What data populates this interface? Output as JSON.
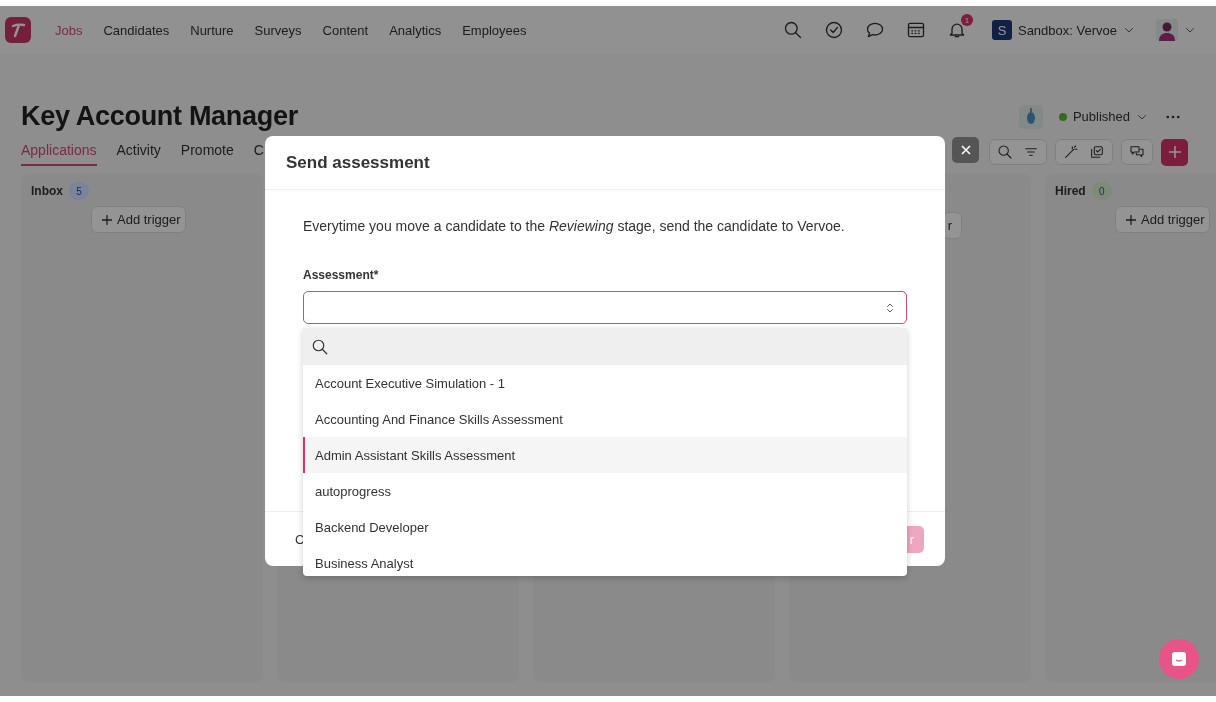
{
  "nav": {
    "items": [
      {
        "label": "Jobs",
        "selected": true
      },
      {
        "label": "Candidates",
        "selected": false
      },
      {
        "label": "Nurture",
        "selected": false
      },
      {
        "label": "Surveys",
        "selected": false
      },
      {
        "label": "Content",
        "selected": false
      },
      {
        "label": "Analytics",
        "selected": false
      },
      {
        "label": "Employees",
        "selected": false
      }
    ],
    "notification_count": "1",
    "workspace": {
      "initial": "S",
      "name": "Sandbox: Vervoe"
    }
  },
  "job": {
    "title": "Key Account Manager",
    "status": "Published"
  },
  "tabs": [
    {
      "label": "Applications",
      "selected": true
    },
    {
      "label": "Activity",
      "selected": false
    },
    {
      "label": "Promote",
      "selected": false
    },
    {
      "label": "C",
      "selected": false
    }
  ],
  "columns": [
    {
      "kind": "stage",
      "name": "Inbox",
      "count": "5",
      "color": "#7a849c",
      "trigger": "Add trigger"
    },
    {
      "kind": "blank"
    },
    {
      "kind": "blank"
    },
    {
      "kind": "covered",
      "trigger": "r"
    },
    {
      "kind": "stage",
      "name": "Hired",
      "count": "0",
      "color": "#7c8c76",
      "trigger": "Add trigger"
    }
  ],
  "modal": {
    "title": "Send assessment",
    "description": "Everytime you move a candidate to the *Reviewing* stage, send the candidate to Vervoe.",
    "field_label": "Assessment*",
    "footer_buttons": [
      {
        "label": "C",
        "kind": "text"
      },
      {
        "label": "r",
        "kind": "primary"
      }
    ]
  },
  "dropdown": {
    "options": [
      {
        "label": "Account Executive Simulation - 1",
        "selected": false
      },
      {
        "label": "Accounting And Finance Skills Assessment",
        "selected": false
      },
      {
        "label": "Admin Assistant Skills Assessment",
        "selected": true
      },
      {
        "label": "autoprogress",
        "selected": false
      },
      {
        "label": "Backend Developer",
        "selected": false
      },
      {
        "label": "Business Analyst",
        "selected": false
      }
    ]
  }
}
